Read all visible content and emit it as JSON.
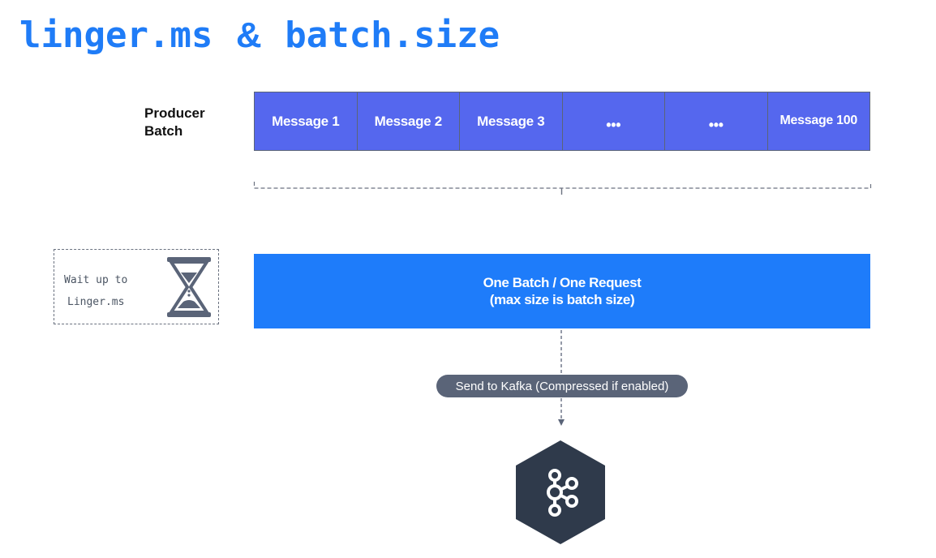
{
  "title": {
    "part1": "linger.ms",
    "amp": "&",
    "part2": "batch.size"
  },
  "producer_batch": {
    "label_line1": "Producer",
    "label_line2": "Batch",
    "messages": [
      "Message 1",
      "Message 2",
      "Message 3",
      "•••",
      "•••",
      "Message 100"
    ]
  },
  "wait": {
    "line1": "Wait up to",
    "line2": "Linger.ms",
    "icon": "hourglass-icon"
  },
  "request": {
    "line1": "One Batch / One Request",
    "line2": "(max size is batch size)"
  },
  "send": {
    "label": "Send to Kafka (Compressed if enabled)"
  },
  "kafka": {
    "icon": "kafka-logo-icon"
  },
  "colors": {
    "title": "#1f7cf7",
    "message_cell": "#5567ee",
    "request_box": "#1e7cfa",
    "pill": "#5a6478",
    "kafka_hex": "#2f3a4b",
    "hourglass": "#5a6478"
  }
}
